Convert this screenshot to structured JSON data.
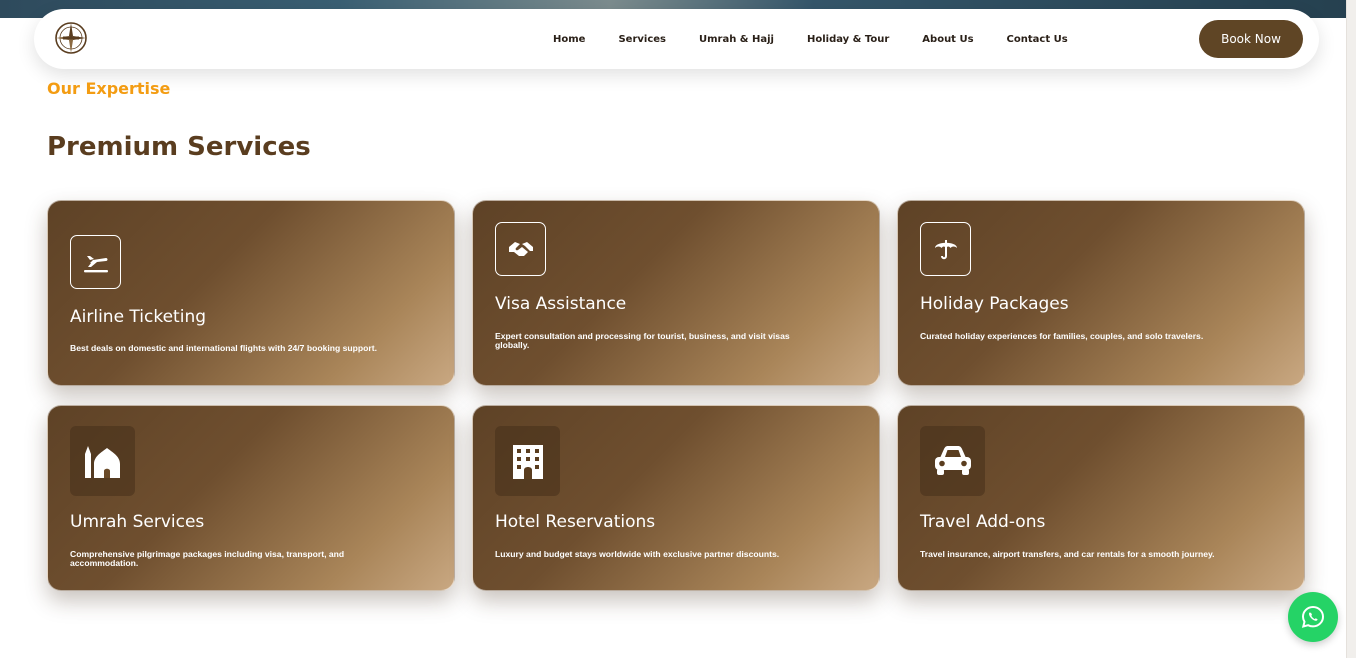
{
  "nav": {
    "links": [
      "Home",
      "Services",
      "Umrah & Hajj",
      "Holiday & Tour",
      "About Us",
      "Contact Us"
    ],
    "book_label": "Book Now"
  },
  "section": {
    "eyebrow": "Our Expertise",
    "title": "Premium Services"
  },
  "services": [
    {
      "title": "Airline Ticketing",
      "desc": "Best deals on domestic and international flights with 24/7 booking support.",
      "icon": "plane-icon"
    },
    {
      "title": "Visa Assistance",
      "desc": "Expert consultation and processing for tourist, business, and visit visas globally.",
      "icon": "handshake-icon"
    },
    {
      "title": "Holiday Packages",
      "desc": "Curated holiday experiences for families, couples, and solo travelers.",
      "icon": "umbrella-icon"
    },
    {
      "title": "Umrah Services",
      "desc": "Comprehensive pilgrimage packages including visa, transport, and accommodation.",
      "icon": "mosque-icon"
    },
    {
      "title": "Hotel Reservations",
      "desc": "Luxury and budget stays worldwide with exclusive partner discounts.",
      "icon": "hotel-icon"
    },
    {
      "title": "Travel Add-ons",
      "desc": "Travel insurance, airport transfers, and car rentals for a smooth journey.",
      "icon": "car-icon"
    }
  ],
  "colors": {
    "brand": "#5f4525",
    "accent": "#f39c12",
    "whatsapp": "#25d366"
  }
}
